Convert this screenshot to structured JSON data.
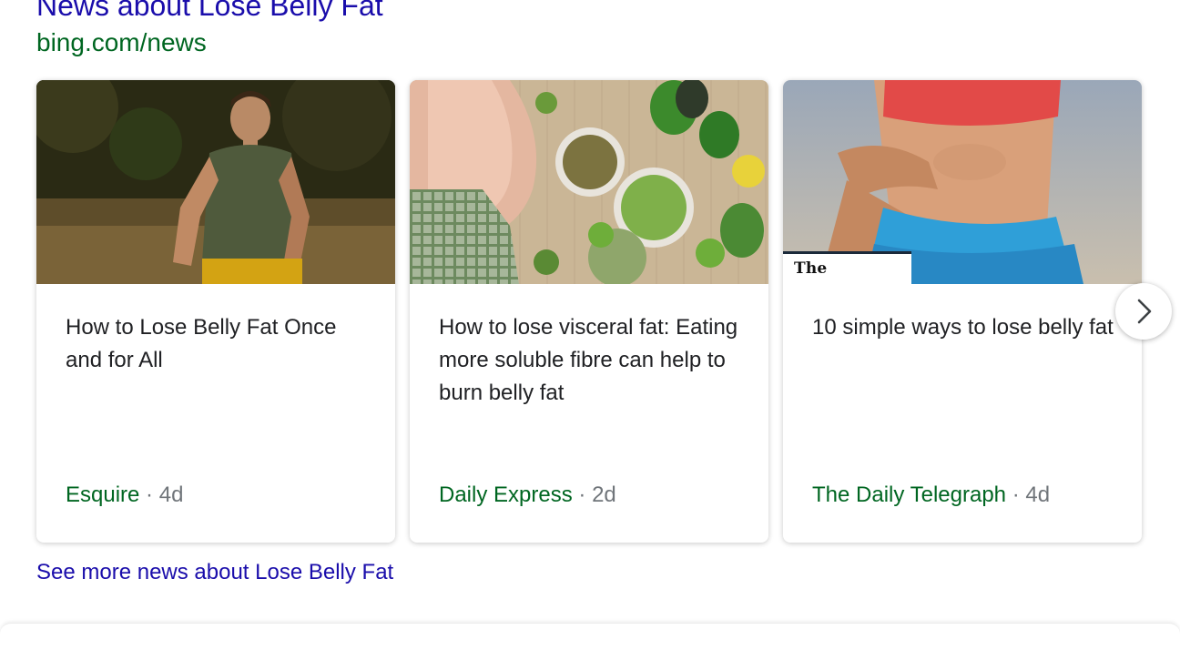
{
  "section": {
    "title": "News about Lose Belly Fat",
    "source_url": "bing.com/news"
  },
  "cards": [
    {
      "title": "How to Lose Belly Fat Once and for All",
      "source": "Esquire",
      "separator": "·",
      "age": "4d",
      "image": "man-jogging-photo"
    },
    {
      "title": "How to lose visceral fat: Eating more soluble fibre can help to burn belly fat",
      "source": "Daily Express",
      "separator": "·",
      "age": "2d",
      "image": "belly-and-vegetables-photo"
    },
    {
      "title": "10 simple ways to lose belly fat",
      "source": "The Daily Telegraph",
      "separator": "·",
      "age": "4d",
      "image": "toned-abs-photo",
      "badge": "The Telegraph"
    }
  ],
  "navigation": {
    "next_icon": "chevron-right-icon"
  },
  "see_more": "See more news about Lose Belly Fat",
  "colors": {
    "link": "#1a0dab",
    "source_green": "#006621",
    "meta_gray": "#70757a",
    "title_text": "#202124"
  }
}
